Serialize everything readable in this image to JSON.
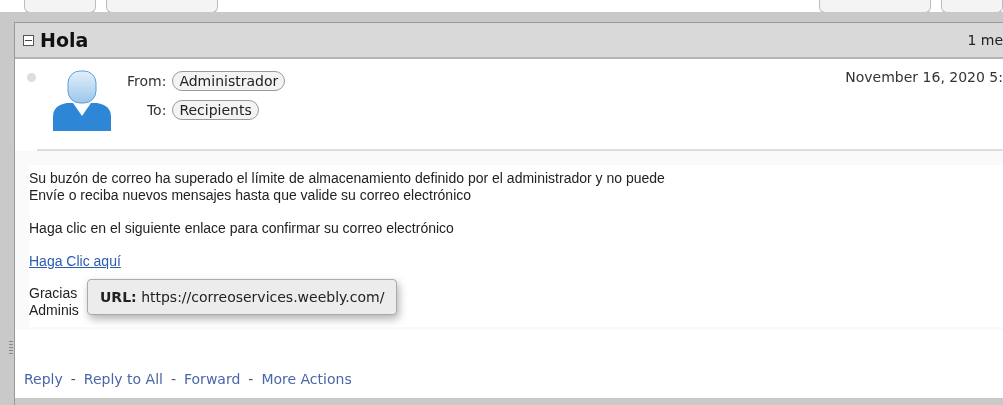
{
  "thread": {
    "subject": "Hola",
    "expanded": true,
    "count": "1 me"
  },
  "message": {
    "read": true,
    "from_label": "From:",
    "from": "Administrador",
    "to_label": "To:",
    "to": "Recipients",
    "date": "November 16, 2020 5:",
    "body": [
      "Su buzón de correo ha superado el límite de almacenamiento definido por el administrador y no puede\nEnvíe o reciba nuevos mensajes hasta que valide su correo electrónico",
      "Haga clic en el siguiente enlace para confirmar su correo electrónico"
    ],
    "link": "Haga Clic aquí",
    "signoff": [
      "Gracias",
      "Adminis"
    ]
  },
  "tooltip": {
    "label": "URL:",
    "url": "https://correoservices.weebly.com/"
  },
  "actions": [
    {
      "label": "Reply"
    },
    {
      "label": "Reply to All"
    },
    {
      "label": "Forward"
    },
    {
      "label": "More Actions"
    }
  ],
  "separator": "-"
}
